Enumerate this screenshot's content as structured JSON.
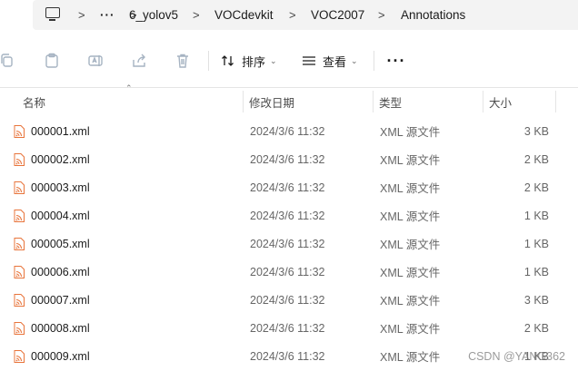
{
  "address": {
    "more": "···",
    "crumbs": [
      "6_yolov5",
      "VOCdevkit",
      "VOC2007",
      "Annotations"
    ],
    "separator": ">"
  },
  "toolbar": {
    "sort_label": "排序",
    "view_label": "查看",
    "more_label": "···",
    "disabled_color": "#a6b3c2"
  },
  "columns": {
    "name": "名称",
    "date": "修改日期",
    "type": "类型",
    "size": "大小"
  },
  "files": [
    {
      "name": "000001.xml",
      "date": "2024/3/6 11:32",
      "type": "XML 源文件",
      "size": "3 KB"
    },
    {
      "name": "000002.xml",
      "date": "2024/3/6 11:32",
      "type": "XML 源文件",
      "size": "2 KB"
    },
    {
      "name": "000003.xml",
      "date": "2024/3/6 11:32",
      "type": "XML 源文件",
      "size": "2 KB"
    },
    {
      "name": "000004.xml",
      "date": "2024/3/6 11:32",
      "type": "XML 源文件",
      "size": "1 KB"
    },
    {
      "name": "000005.xml",
      "date": "2024/3/6 11:32",
      "type": "XML 源文件",
      "size": "1 KB"
    },
    {
      "name": "000006.xml",
      "date": "2024/3/6 11:32",
      "type": "XML 源文件",
      "size": "1 KB"
    },
    {
      "name": "000007.xml",
      "date": "2024/3/6 11:32",
      "type": "XML 源文件",
      "size": "3 KB"
    },
    {
      "name": "000008.xml",
      "date": "2024/3/6 11:32",
      "type": "XML 源文件",
      "size": "2 KB"
    },
    {
      "name": "000009.xml",
      "date": "2024/3/6 11:32",
      "type": "XML 源文件",
      "size": "1 KB"
    }
  ],
  "watermark": "CSDN @YANG362",
  "icons": {
    "file": "xml-file-icon",
    "accent": "#e8743b"
  }
}
